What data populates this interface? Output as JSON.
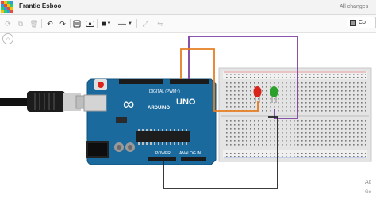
{
  "app": {
    "title": "Frantic Esboo",
    "status": "All changes",
    "code_button_label": "Co"
  },
  "toolbar": {
    "color_label": "■",
    "line_label": "—"
  },
  "board": {
    "brand": "ARDUINO",
    "model": "UNO",
    "digital_label": "DIGITAL (PWM~)",
    "power_label": "POWER",
    "analog_label": "ANALOG IN",
    "logo": "∞"
  },
  "watermark": {
    "line1": "Ac",
    "line2": "Go"
  },
  "colors": {
    "board": "#1a6a9e",
    "wire_orange": "#e67e22",
    "wire_purple": "#7b3fa0",
    "wire_black": "#222222",
    "led_red": "#d9241b",
    "led_green": "#2ca02c"
  }
}
